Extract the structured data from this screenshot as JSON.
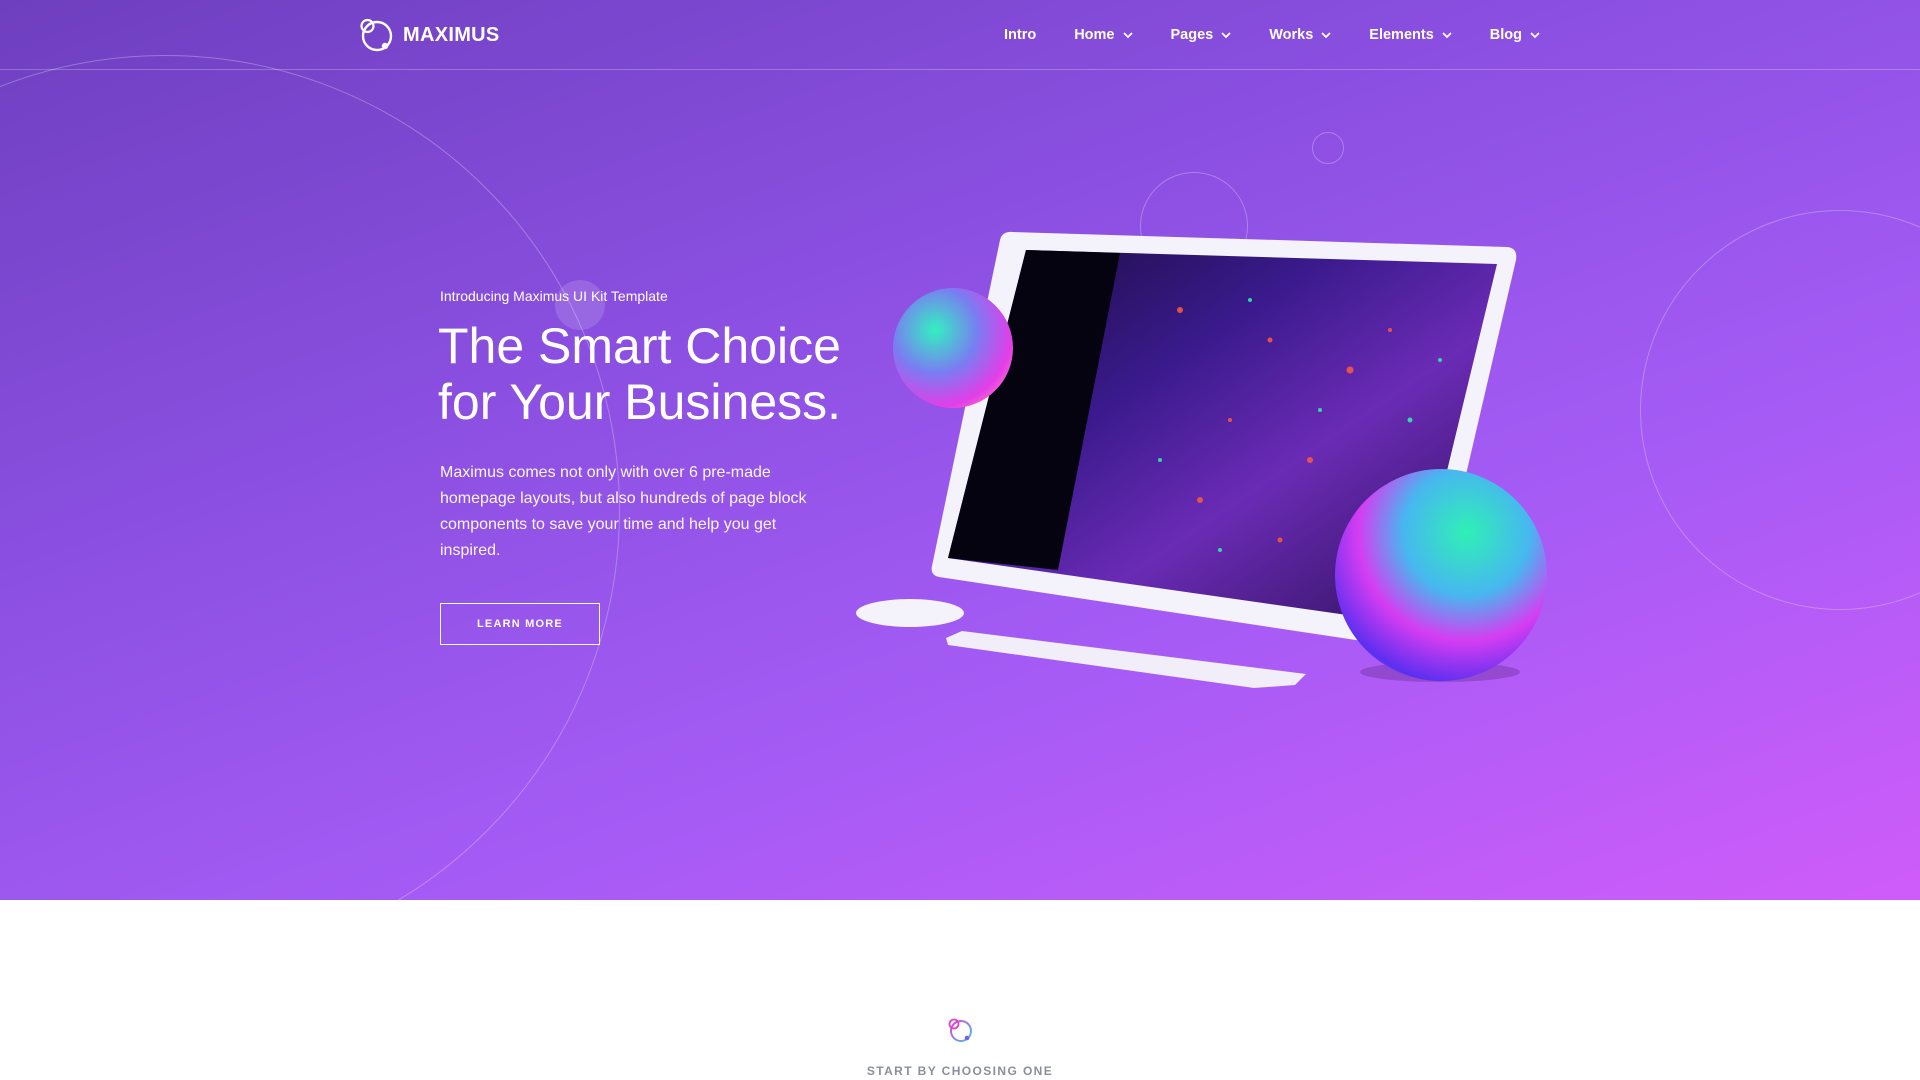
{
  "brand": {
    "name": "MAXIMUS",
    "icon": "maximus-ring-logo"
  },
  "nav": {
    "items": [
      {
        "label": "Intro",
        "has_dropdown": false
      },
      {
        "label": "Home",
        "has_dropdown": true
      },
      {
        "label": "Pages",
        "has_dropdown": true
      },
      {
        "label": "Works",
        "has_dropdown": true
      },
      {
        "label": "Elements",
        "has_dropdown": true
      },
      {
        "label": "Blog",
        "has_dropdown": true
      }
    ]
  },
  "hero": {
    "eyebrow": "Introducing Maximus UI Kit Template",
    "headline_line1": "The Smart Choice",
    "headline_line2": "for Your Business.",
    "description": "Maximus comes not only with over 6 pre-made homepage layouts, but also hundreds of page block components to save your time and help you get inspired.",
    "cta_label": "LEARN MORE"
  },
  "next_section": {
    "icon": "maximus-ring-logo",
    "kicker": "START BY CHOOSING ONE"
  },
  "colors": {
    "gradient_start": "#6e3fbf",
    "gradient_end": "#cf5cfa",
    "text_light": "#ffffff",
    "kicker_gray": "#8a8f9c"
  }
}
